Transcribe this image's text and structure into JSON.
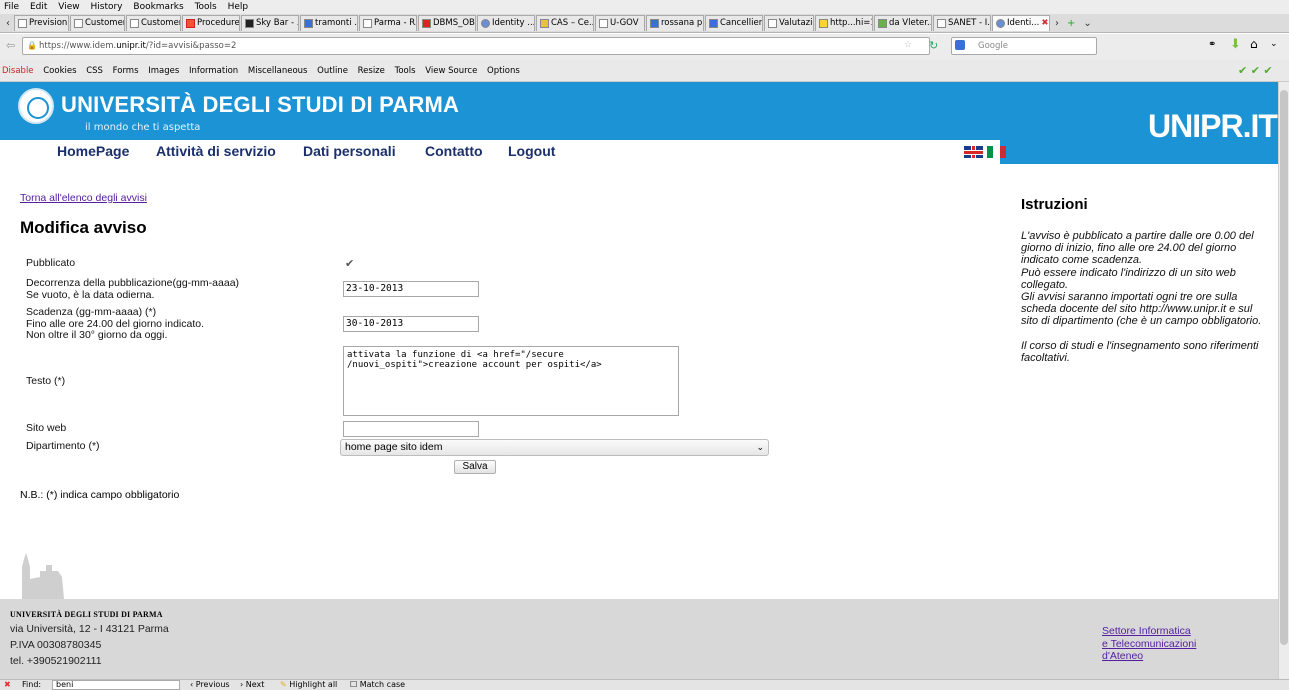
{
  "browser": {
    "menu": [
      "File",
      "Edit",
      "View",
      "History",
      "Bookmarks",
      "Tools",
      "Help"
    ],
    "tabs": [
      "Prevision...",
      "Customer...",
      "Customer...",
      "Procedure",
      "Sky Bar - ...",
      "tramonti ...",
      "Parma - R...",
      "DBMS_OB...",
      "Identity ...",
      "CAS – Ce...",
      "U-GOV",
      "rossana p...",
      "Cancellier...",
      "Valutazio...",
      "http...hi=1",
      "da Vleter...",
      "SANET - I...",
      "Identi..."
    ],
    "url_prefix": "https://www.idem.",
    "url_domain": "unipr.it",
    "url_suffix": "/?id=avvisi&passo=2",
    "search_placeholder": "Google",
    "devtools": [
      "Disable",
      "Cookies",
      "CSS",
      "Forms",
      "Images",
      "Information",
      "Miscellaneous",
      "Outline",
      "Resize",
      "Tools",
      "View Source",
      "Options"
    ]
  },
  "header": {
    "university_name": "UNIVERSITÀ DEGLI STUDI DI PARMA",
    "tagline": "il mondo che ti aspetta",
    "brand": "UNIPR.IT"
  },
  "nav": [
    "HomePage",
    "Attività di servizio",
    "Dati personali",
    "Contatto",
    "Logout"
  ],
  "form": {
    "back_link": "Torna all'elenco degli avvisi",
    "title": "Modifica avviso",
    "pubblicato_label": "Pubblicato",
    "decorrenza_label_1": "Decorrenza della pubblicazione(gg-mm-aaaa)",
    "decorrenza_label_2": "Se vuoto, è la data odierna.",
    "decorrenza_value": "23-10-2013",
    "scadenza_label_1": "Scadenza (gg-mm-aaaa) (*)",
    "scadenza_label_2": "Fino alle ore 24.00 del giorno indicato.",
    "scadenza_label_3": "Non oltre il 30° giorno da oggi.",
    "scadenza_value": "30-10-2013",
    "testo_label": "Testo (*)",
    "testo_value": "attivata la funzione di <a href=\"/secure\n/nuovi_ospiti\">creazione account per ospiti</a>",
    "sito_label": "Sito web",
    "sito_value": "",
    "dipartimento_label": "Dipartimento (*)",
    "dipartimento_value": "home page sito idem",
    "save_label": "Salva",
    "note": "N.B.: (*) indica campo obbligatorio"
  },
  "sidebar": {
    "title": "Istruzioni",
    "paragraph_1": "L'avviso è pubblicato a partire dalle ore 0.00 del giorno di inizio, fino alle ore 24.00 del giorno indicato come scadenza.",
    "paragraph_2": "Può essere indicato l'indirizzo di un sito web collegato.",
    "paragraph_3": "Gli avvisi saranno importati ogni tre ore sulla scheda docente del sito http://www.unipr.it e sul sito di dipartimento (che è un campo obbligatorio.",
    "paragraph_4": "Il corso di studi e l'insegnamento sono riferimenti facoltativi."
  },
  "footer": {
    "name": "UNIVERSITÀ DEGLI STUDI DI PARMA",
    "address": "via Università, 12 - I 43121 Parma",
    "piva": "P.IVA 00308780345",
    "tel": "tel. +390521902111",
    "link_1": "Settore Informatica",
    "link_2": "e Telecomunicazioni",
    "link_3": "d'Ateneo"
  },
  "findbar": {
    "label": "Find:",
    "value": "beni",
    "previous": "Previous",
    "next": "Next",
    "highlight": "Highlight all",
    "match_case": "Match case"
  },
  "colors": {
    "banner_blue": "#1b93d4",
    "nav_text": "#1a2f6b",
    "link_purple": "#5520a0",
    "footer_gray": "#d8d8d8"
  }
}
